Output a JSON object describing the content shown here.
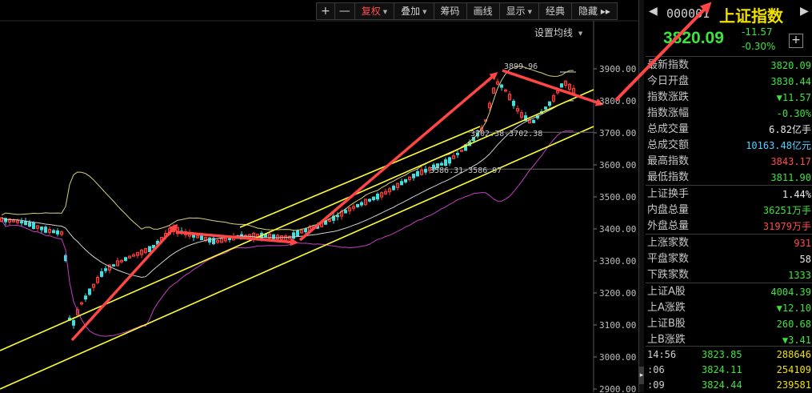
{
  "toolbar": {
    "plus": "+",
    "minus": "—",
    "buttons": [
      {
        "label": "复权",
        "dropdown": true,
        "active": true
      },
      {
        "label": "叠加",
        "dropdown": true,
        "active": false
      },
      {
        "label": "筹码",
        "dropdown": false,
        "active": false
      },
      {
        "label": "画线",
        "dropdown": false,
        "active": false
      },
      {
        "label": "显示",
        "dropdown": true,
        "active": false
      },
      {
        "label": "经典",
        "dropdown": false,
        "active": false
      },
      {
        "label": "隐藏",
        "dropdown": false,
        "active": false
      }
    ],
    "more": "▸▸"
  },
  "settings_ma": "设置均线",
  "chart": {
    "y_ticks": [
      "3900.00",
      "3800.00",
      "3700.00",
      "3600.00",
      "3500.00",
      "3400.00",
      "3300.00",
      "3200.00",
      "3100.00",
      "3000.00",
      "2900.00"
    ],
    "annotations": {
      "high": "3899.96",
      "mid1": "3702.38-3702.38",
      "mid2": "3586.31-3586.97"
    }
  },
  "chart_data": {
    "type": "candlestick",
    "y_axis_ticks": [
      3900,
      3800,
      3700,
      3600,
      3500,
      3400,
      3300,
      3200,
      3100,
      3000,
      2900
    ],
    "ylim": [
      2880,
      3940
    ],
    "annotated_values": {
      "high": 3899.96,
      "level_1": 3702.38,
      "level_2": 3586.31
    },
    "trend_arrows": 6,
    "channel_lines": 3
  },
  "quote": {
    "code": "000001",
    "name": "上证指数",
    "price": "3820.09",
    "change": "-11.57",
    "change_pct": "-0.30%",
    "add_label": "+"
  },
  "stats": [
    {
      "label": "最新指数",
      "value": "3820.09",
      "color": "#3ee43e"
    },
    {
      "label": "今日开盘",
      "value": "3830.44",
      "color": "#3ee43e"
    },
    {
      "label": "指数涨跌",
      "value": "▼11.57",
      "color": "#3ee43e"
    },
    {
      "label": "指数涨幅",
      "value": "-0.30%",
      "color": "#3ee43e"
    },
    {
      "label": "总成交量",
      "value": "6.82亿手",
      "color": "#e8e8e8"
    },
    {
      "label": "总成交额",
      "value": "10163.48亿元",
      "color": "#4fd0ff"
    },
    {
      "label": "最高指数",
      "value": "3843.17",
      "color": "#ff4b4b"
    },
    {
      "label": "最低指数",
      "value": "3811.90",
      "color": "#3ee43e"
    },
    {
      "label": "上证换手",
      "value": "1.44%",
      "color": "#e8e8e8"
    },
    {
      "label": "内盘总量",
      "value": "36251万手",
      "color": "#3ee43e"
    },
    {
      "label": "外盘总量",
      "value": "31979万手",
      "color": "#ff4b4b"
    },
    {
      "label": "上涨家数",
      "value": "931",
      "color": "#ff4b4b"
    },
    {
      "label": "平盘家数",
      "value": "58",
      "color": "#e8e8e8"
    },
    {
      "label": "下跌家数",
      "value": "1333",
      "color": "#3ee43e"
    },
    {
      "label": "上证A股",
      "value": "4004.39",
      "color": "#3ee43e"
    },
    {
      "label": "上A涨跌",
      "value": "▼12.10",
      "color": "#3ee43e"
    },
    {
      "label": "上证B股",
      "value": "260.68",
      "color": "#3ee43e"
    },
    {
      "label": "上B涨跌",
      "value": "▼3.41",
      "color": "#3ee43e"
    }
  ],
  "ticks": [
    {
      "time": "14:56",
      "price": "3823.85",
      "volume": "288646"
    },
    {
      "time": ":06",
      "price": "3824.11",
      "volume": "254109"
    },
    {
      "time": ":09",
      "price": "3824.44",
      "volume": "239581"
    }
  ],
  "colors": {
    "up": "#ff3b3b",
    "down": "#3ee0e0",
    "ma": "#d0d0d0",
    "boll_upper": "#e8e060",
    "boll_lower": "#c040c0",
    "channel": "#ffff30",
    "arrow": "#ff4545",
    "price_green": "#3ee43e",
    "title_yellow": "#f0e000"
  }
}
